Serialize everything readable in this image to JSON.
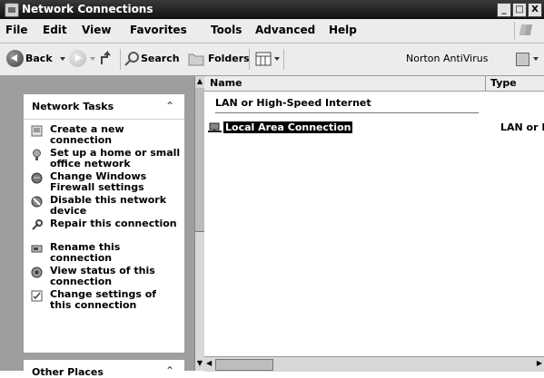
{
  "window": {
    "title": "Network Connections",
    "min_glyph": "_",
    "max_glyph": "□",
    "close_glyph": "X"
  },
  "menu": [
    "File",
    "Edit",
    "View",
    "Favorites",
    "Tools",
    "Advanced",
    "Help"
  ],
  "toolbar": {
    "back": "Back",
    "search": "Search",
    "folders": "Folders",
    "norton": "Norton AntiVirus"
  },
  "tasks": {
    "title": "Network Tasks",
    "collapse_glyph": "⌃",
    "items": [
      {
        "label": "Create a new connection",
        "icon": "new-connection-icon"
      },
      {
        "label": "Set up a home or small office network",
        "icon": "home-network-icon"
      },
      {
        "label": "Change Windows Firewall settings",
        "icon": "firewall-icon"
      },
      {
        "label": "Disable this network device",
        "icon": "disable-icon"
      },
      {
        "label": "Repair this connection",
        "icon": "repair-icon"
      },
      {
        "label": "Rename this connection",
        "icon": "rename-icon"
      },
      {
        "label": "View status of this connection",
        "icon": "status-icon"
      },
      {
        "label": "Change settings of this connection",
        "icon": "settings-icon"
      }
    ]
  },
  "other_places": {
    "title": "Other Places",
    "collapse_glyph": "⌃"
  },
  "list": {
    "columns": {
      "name": "Name",
      "type": "Type"
    },
    "group": "LAN or High-Speed Internet",
    "rows": [
      {
        "name": "Local Area Connection",
        "type": "LAN or Hi"
      }
    ]
  },
  "colors": {
    "titlebar": "#1a1a1a",
    "taskpane": "#9e9e9e",
    "selection": "#000000"
  }
}
